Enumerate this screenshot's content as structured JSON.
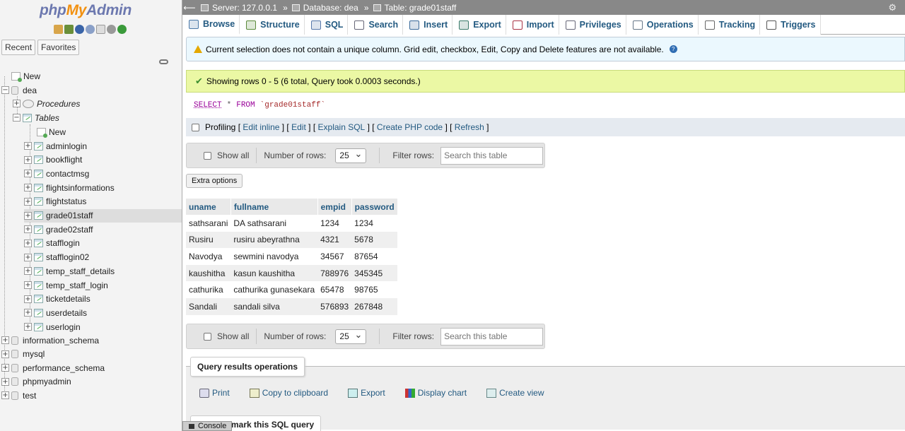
{
  "nav": {
    "logo": {
      "php": "php",
      "my": "My",
      "admin": "Admin"
    },
    "tabs": [
      "Recent",
      "Favorites"
    ],
    "tree": {
      "new": "New",
      "db": "dea",
      "procedures": "Procedures",
      "tables_group": "Tables",
      "tables_new": "New",
      "tables": [
        "adminlogin",
        "bookflight",
        "contactmsg",
        "flightsinformations",
        "flightstatus",
        "grade01staff",
        "grade02staff",
        "stafflogin",
        "stafflogin02",
        "temp_staff_details",
        "temp_staff_login",
        "ticketdetails",
        "userdetails",
        "userlogin"
      ],
      "selected_table": "grade01staff",
      "other_dbs": [
        "information_schema",
        "mysql",
        "performance_schema",
        "phpmyadmin",
        "test"
      ]
    }
  },
  "breadcrumb": {
    "server": "Server: 127.0.0.1",
    "database": "Database: dea",
    "table": "Table: grade01staff",
    "sep": "»"
  },
  "tabs": [
    {
      "label": "Browse",
      "icon": "browse-icon"
    },
    {
      "label": "Structure",
      "icon": "structure-icon"
    },
    {
      "label": "SQL",
      "icon": "sql-icon"
    },
    {
      "label": "Search",
      "icon": "search-icon"
    },
    {
      "label": "Insert",
      "icon": "insert-icon"
    },
    {
      "label": "Export",
      "icon": "export-icon"
    },
    {
      "label": "Import",
      "icon": "import-icon"
    },
    {
      "label": "Privileges",
      "icon": "privileges-icon"
    },
    {
      "label": "Operations",
      "icon": "operations-icon"
    },
    {
      "label": "Tracking",
      "icon": "tracking-icon"
    },
    {
      "label": "Triggers",
      "icon": "triggers-icon"
    }
  ],
  "notice": "Current selection does not contain a unique column. Grid edit, checkbox, Edit, Copy and Delete features are not available.",
  "success": "Showing rows 0 - 5 (6 total, Query took 0.0003 seconds.)",
  "sql": {
    "select": "SELECT",
    "star": "*",
    "from": "FROM",
    "table": "`grade01staff`"
  },
  "profiling": {
    "label": "Profiling",
    "links": [
      "Edit inline",
      "Edit",
      "Explain SQL",
      "Create PHP code",
      "Refresh"
    ],
    "lb": "[",
    "rb": "]",
    "sep": "] ["
  },
  "table_nav": {
    "show_all": "Show all",
    "rows_label": "Number of rows:",
    "rows_value": "25",
    "filter_label": "Filter rows:",
    "filter_placeholder": "Search this table"
  },
  "extra_options": "Extra options",
  "columns": [
    "uname",
    "fullname",
    "empid",
    "password"
  ],
  "rows": [
    [
      "sathsarani",
      "DA sathsarani",
      "1234",
      "1234"
    ],
    [
      "Rusiru",
      "rusiru abeyrathna",
      "4321",
      "5678"
    ],
    [
      "Navodya",
      "sewmini navodya",
      "34567",
      "87654"
    ],
    [
      "kaushitha",
      "kasun kaushitha",
      "788976",
      "345345"
    ],
    [
      "cathurika",
      "cathurika gunasekara",
      "65478",
      "98765"
    ],
    [
      "Sandali",
      "sandali silva",
      "576893",
      "267848"
    ]
  ],
  "qro": {
    "legend": "Query results operations",
    "links": [
      "Print",
      "Copy to clipboard",
      "Export",
      "Display chart",
      "Create view"
    ]
  },
  "bookmark": "mark this SQL query",
  "console": "Console"
}
